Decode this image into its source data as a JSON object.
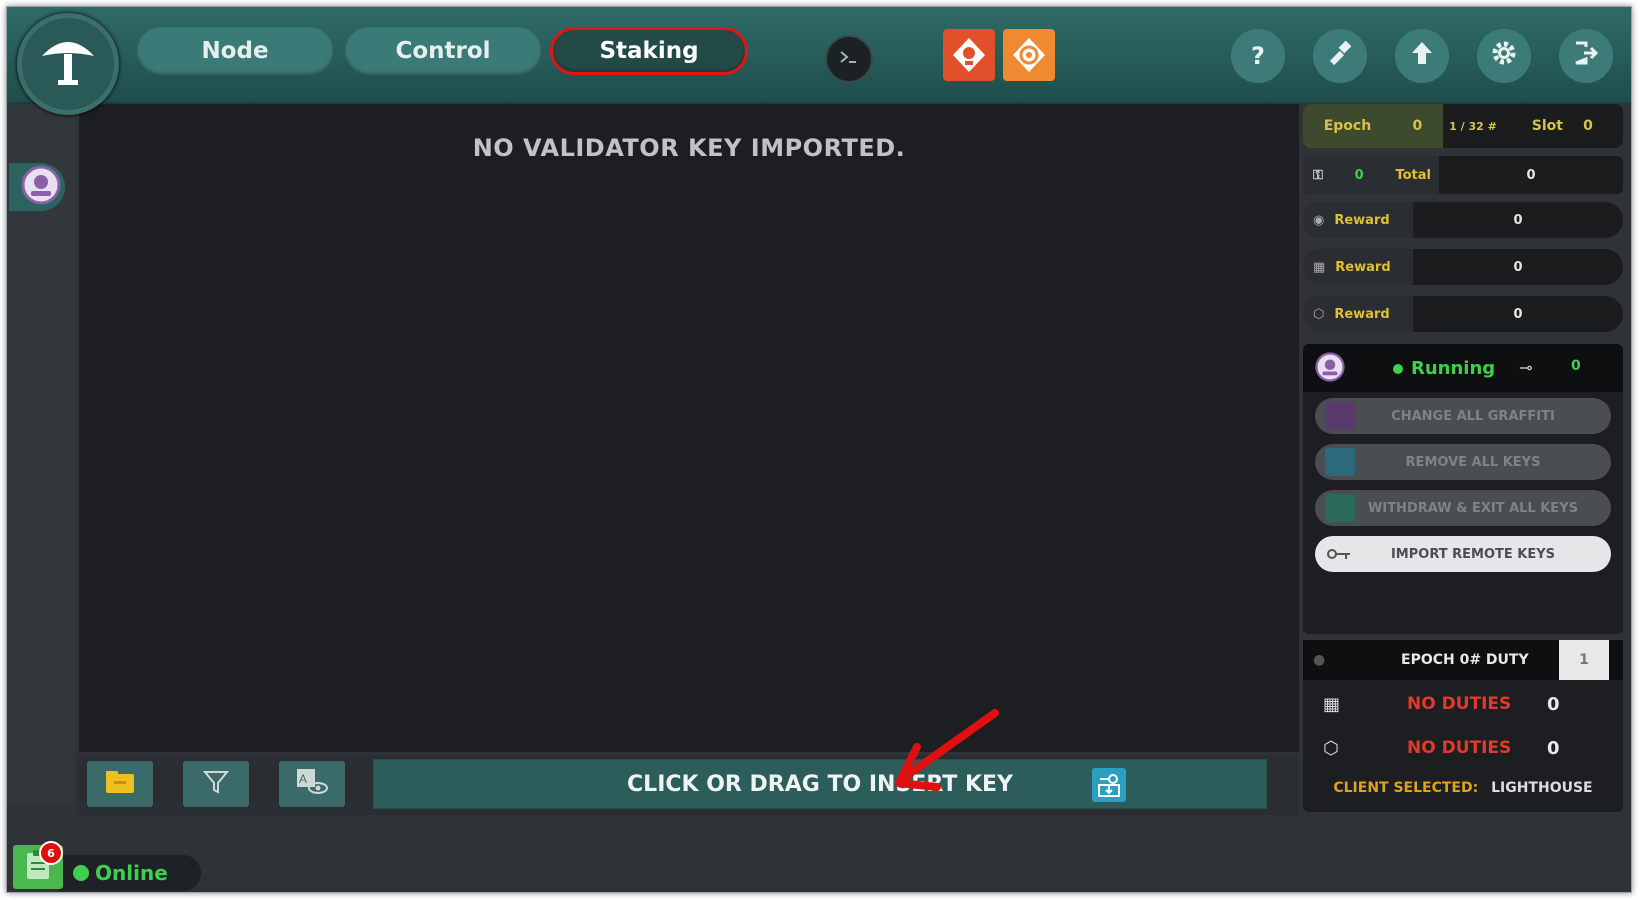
{
  "header": {
    "nav": [
      {
        "label": "Node"
      },
      {
        "label": "Control"
      },
      {
        "label": "Staking"
      }
    ],
    "active_nav": "Staking",
    "plugin_icons": [
      "prometheus-icon",
      "grafana-icon"
    ],
    "right_buttons": [
      {
        "icon": "help-icon",
        "label": "?"
      },
      {
        "icon": "hammer-icon"
      },
      {
        "icon": "update-arrow-icon"
      },
      {
        "icon": "gear-icon"
      },
      {
        "icon": "logout-icon"
      }
    ]
  },
  "main": {
    "empty_message": "NO VALIDATOR KEY IMPORTED.",
    "insert_key_label": "CLICK OR DRAG TO INSERT KEY"
  },
  "status": {
    "online_label": "Online",
    "notification_count": "6"
  },
  "right_panel": {
    "epoch_label": "Epoch",
    "epoch_value": "0",
    "epoch_fraction": "1 / 32 #",
    "slot_label": "Slot",
    "slot_value": "0",
    "keys_count": "0",
    "total_label": "Total",
    "total_value": "0",
    "rewards": [
      {
        "icon": "eye-icon",
        "label": "Reward",
        "value": "0"
      },
      {
        "icon": "calendar-icon",
        "label": "Reward",
        "value": "0"
      },
      {
        "icon": "cube-icon",
        "label": "Reward",
        "value": "0"
      }
    ],
    "service": {
      "state": "Running",
      "key_count": "0",
      "actions": [
        {
          "label": "CHANGE ALL GRAFFITI",
          "enabled": false,
          "color": "#5a3a6a"
        },
        {
          "label": "REMOVE ALL KEYS",
          "enabled": false,
          "color": "#2a6a7a"
        },
        {
          "label": "WITHDRAW & EXIT ALL KEYS",
          "enabled": false,
          "color": "#2a6a5a"
        },
        {
          "label": "IMPORT REMOTE KEYS",
          "enabled": true,
          "color": "#e4e6e8"
        }
      ]
    },
    "duty": {
      "title": "EPOCH 0# DUTY",
      "value": "1",
      "rows": [
        {
          "icon": "calendar-icon",
          "label": "NO DUTIES",
          "count": "0"
        },
        {
          "icon": "cube-icon",
          "label": "NO DUTIES",
          "count": "0"
        }
      ],
      "client_label": "CLIENT SELECTED:",
      "client_value": "LIGHTHOUSE"
    }
  },
  "colors": {
    "accent": "#3b7b77",
    "highlight": "#e01515",
    "online": "#3fcf4f",
    "warning_text": "#e0c030",
    "error_text": "#e23a2a"
  }
}
